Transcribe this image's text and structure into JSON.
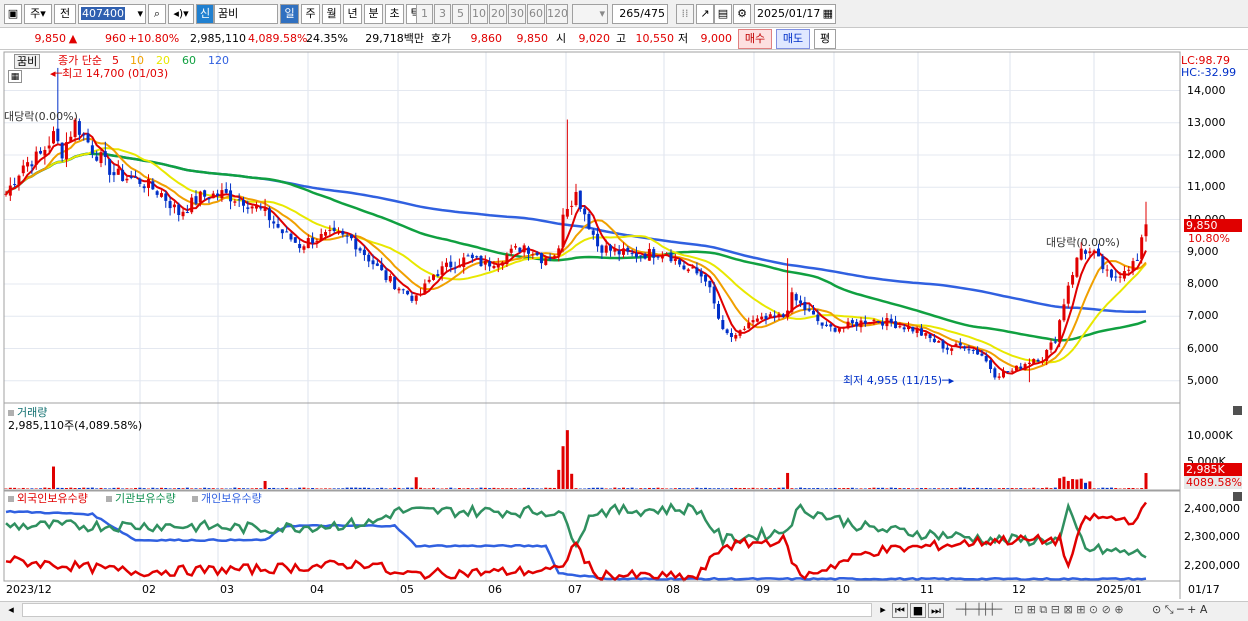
{
  "toolbar": {
    "type_select": "주",
    "jeon_btn": "전",
    "code": "407400",
    "sin": "신",
    "name": "꿈비",
    "periods": [
      "일",
      "주",
      "월",
      "년",
      "분",
      "초",
      "틱"
    ],
    "nums": [
      "1",
      "3",
      "5",
      "10",
      "20",
      "30",
      "60",
      "120"
    ],
    "count": "265",
    "total": "/475",
    "date": "2025/01/17"
  },
  "quote": {
    "price": "9,850",
    "arrow": "▲",
    "change": "960",
    "pct": "+10.80%",
    "volume": "2,985,110",
    "vol_ratio": "4,089.58%",
    "turnover": "24.35%",
    "amount": "29,718백만",
    "hoga_label": "호가",
    "hoga1": "9,860",
    "hoga2": "9,850",
    "open_label": "시",
    "open": "9,020",
    "high_label": "고",
    "high": "10,550",
    "low_label": "저",
    "low": "9,000",
    "buy": "매수",
    "sell": "매도",
    "eval": "평"
  },
  "price_panel": {
    "stock_tag": "꿈비",
    "legend_prefix": "종가 단순",
    "ma": [
      {
        "p": "5",
        "color": "#e00000"
      },
      {
        "p": "10",
        "color": "#f0a000"
      },
      {
        "p": "20",
        "color": "#e8e800"
      },
      {
        "p": "60",
        "color": "#10a040"
      },
      {
        "p": "120",
        "color": "#3060e0"
      }
    ],
    "high_note": "최고 14,700 (01/03)",
    "low_note": "최저 4,955 (11/15)",
    "left_note": "대당락(0.00%)",
    "right_note": "대당락(0.00%)",
    "lc": "LC:98.79",
    "hc": "HC:-32.99",
    "yticks": [
      "14,000",
      "13,000",
      "12,000",
      "11,000",
      "10,000",
      "9,000",
      "8,000",
      "7,000",
      "6,000",
      "5,000"
    ],
    "cur_price": "9,850",
    "cur_pct": "10.80%"
  },
  "volume_panel": {
    "title": "거래량",
    "value": "2,985,110주(4,089.58%)",
    "yticks": [
      "10,000K",
      "5,000K"
    ],
    "cur_vol": "2,985K",
    "cur_pct": "4089.58%"
  },
  "holding_panel": {
    "legend": [
      {
        "name": "외국인보유수량",
        "color": "#e00000"
      },
      {
        "name": "기관보유수량",
        "color": "#109050"
      },
      {
        "name": "개인보유수량",
        "color": "#3060e0"
      }
    ],
    "yticks": [
      "2,400,000",
      "2,300,000",
      "2,200,000"
    ]
  },
  "xaxis": [
    "2023/12",
    "02",
    "03",
    "04",
    "05",
    "06",
    "07",
    "08",
    "09",
    "10",
    "11",
    "12",
    "2025/01",
    "01/17"
  ],
  "colors": {
    "up": "#e00000",
    "down": "#0030c8",
    "ma5": "#e00000",
    "ma10": "#f0a000",
    "ma20": "#e8e800",
    "ma60": "#10a040",
    "ma120": "#3060e0"
  }
}
